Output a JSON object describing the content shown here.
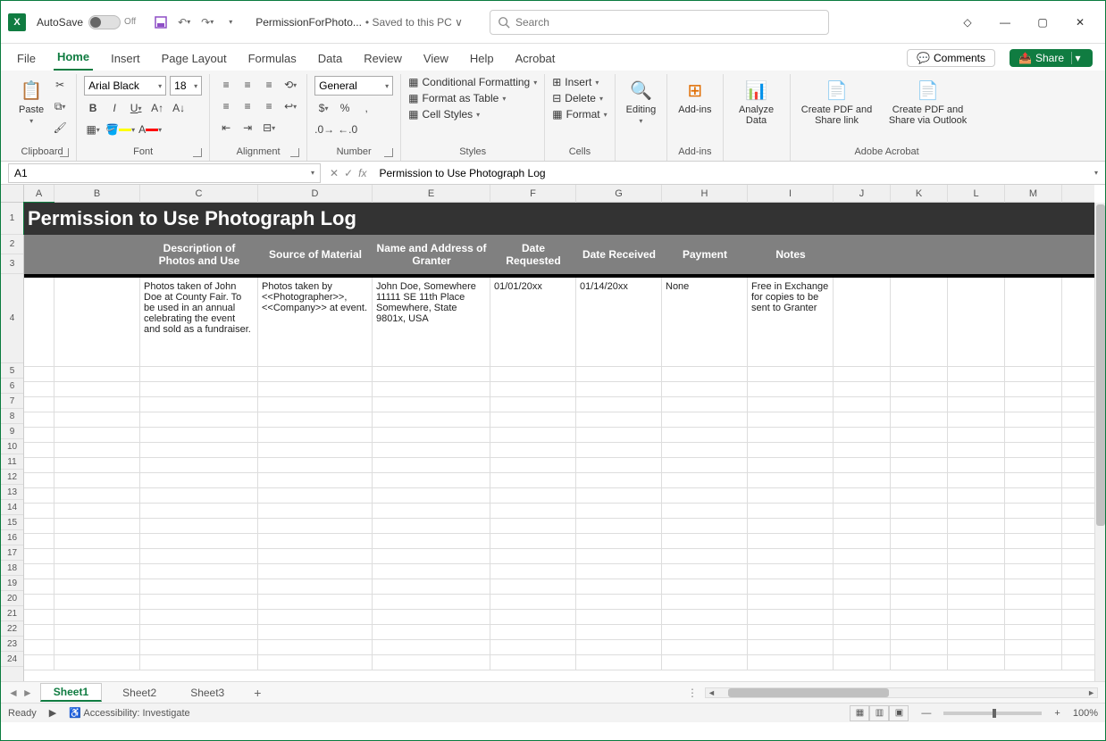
{
  "titlebar": {
    "autosave_label": "AutoSave",
    "autosave_state": "Off",
    "filename": "PermissionForPhoto...",
    "save_status": "• Saved to this PC ∨",
    "search_placeholder": "Search"
  },
  "tabs": {
    "file": "File",
    "home": "Home",
    "insert": "Insert",
    "page_layout": "Page Layout",
    "formulas": "Formulas",
    "data": "Data",
    "review": "Review",
    "view": "View",
    "help": "Help",
    "acrobat": "Acrobat",
    "comments": "Comments",
    "share": "Share"
  },
  "ribbon": {
    "clipboard": {
      "paste": "Paste",
      "label": "Clipboard"
    },
    "font": {
      "name": "Arial Black",
      "size": "18",
      "label": "Font"
    },
    "alignment": {
      "label": "Alignment"
    },
    "number": {
      "format": "General",
      "label": "Number"
    },
    "styles": {
      "cond": "Conditional Formatting",
      "table": "Format as Table",
      "cell": "Cell Styles",
      "label": "Styles"
    },
    "cells": {
      "insert": "Insert",
      "delete": "Delete",
      "format": "Format",
      "label": "Cells"
    },
    "editing": {
      "label": "Editing"
    },
    "addins": {
      "label": "Add-ins"
    },
    "analyze": {
      "label": "Analyze Data"
    },
    "acrobat": {
      "createshare": "Create PDF and Share link",
      "outlook": "Create PDF and Share via Outlook",
      "label": "Adobe Acrobat"
    }
  },
  "formula_bar": {
    "name_box": "A1",
    "formula": "Permission to Use Photograph Log"
  },
  "columns": [
    "A",
    "B",
    "C",
    "D",
    "E",
    "F",
    "G",
    "H",
    "I",
    "J",
    "K",
    "L",
    "M"
  ],
  "sheet": {
    "title": "Permission to Use Photograph Log",
    "headers": {
      "c": "Description of Photos and Use",
      "d": "Source of Material",
      "e": "Name and Address of Granter",
      "f": "Date Requested",
      "g": "Date Received",
      "h": "Payment",
      "i": "Notes"
    },
    "row4": {
      "c": "Photos taken of John Doe at County Fair. To be used in an annual celebrating the event and sold as a fundraiser.",
      "d": "Photos taken by <<Photographer>>, <<Company>> at event.",
      "e": "John Doe, Somewhere\n11111 SE 11th Place\nSomewhere, State 9801x, USA",
      "f": "01/01/20xx",
      "g": "01/14/20xx",
      "h": "None",
      "i": "Free in Exchange for copies to be sent to Granter"
    }
  },
  "sheet_tabs": {
    "s1": "Sheet1",
    "s2": "Sheet2",
    "s3": "Sheet3"
  },
  "statusbar": {
    "ready": "Ready",
    "access": "Accessibility: Investigate",
    "zoom": "100%"
  }
}
